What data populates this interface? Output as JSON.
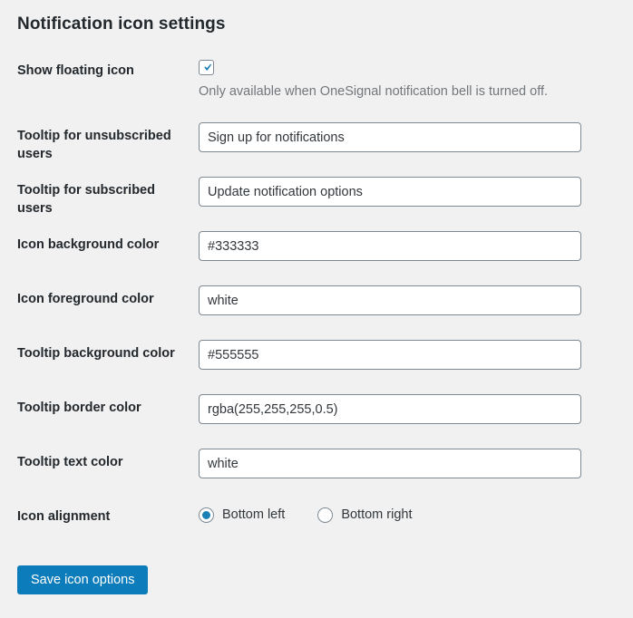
{
  "page": {
    "title": "Notification icon settings",
    "background_color": "#f1f1f1",
    "accent_color": "#0c7cbb"
  },
  "fields": {
    "show_floating_icon": {
      "label": "Show floating icon",
      "checked": true,
      "help_text": "Only available when OneSignal notification bell is turned off."
    },
    "tooltip_unsubscribed": {
      "label": "Tooltip for unsubscribed users",
      "value": "Sign up for notifications"
    },
    "tooltip_subscribed": {
      "label": "Tooltip for subscribed users",
      "value": "Update notification options"
    },
    "icon_background_color": {
      "label": "Icon background color",
      "value": "#333333"
    },
    "icon_foreground_color": {
      "label": "Icon foreground color",
      "value": "white"
    },
    "tooltip_background_color": {
      "label": "Tooltip background color",
      "value": "#555555"
    },
    "tooltip_border_color": {
      "label": "Tooltip border color",
      "value": "rgba(255,255,255,0.5)"
    },
    "tooltip_text_color": {
      "label": "Tooltip text color",
      "value": "white"
    },
    "icon_alignment": {
      "label": "Icon alignment",
      "options": [
        {
          "label": "Bottom left",
          "selected": true
        },
        {
          "label": "Bottom right",
          "selected": false
        }
      ]
    }
  },
  "actions": {
    "save_label": "Save icon options"
  }
}
